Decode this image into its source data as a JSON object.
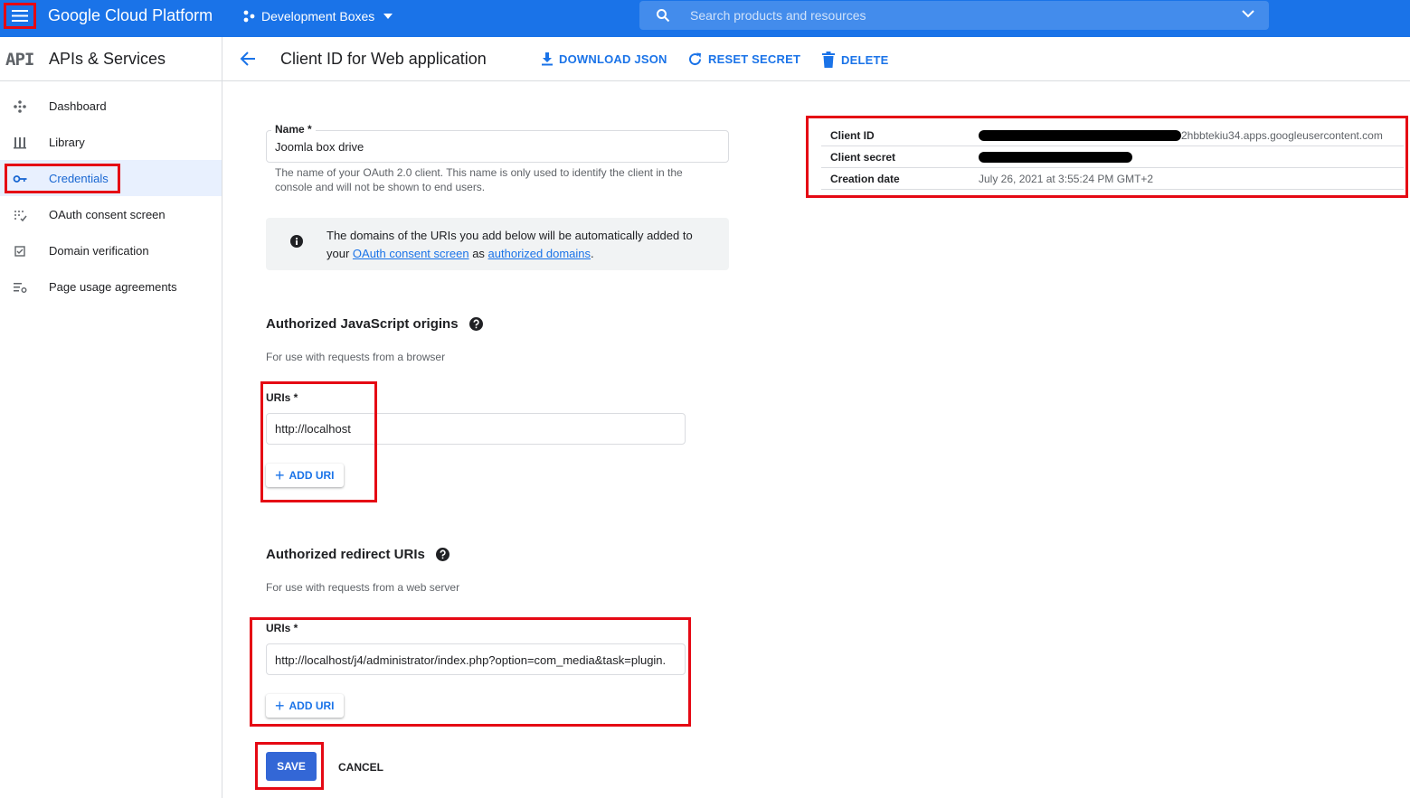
{
  "topbar": {
    "brand": "Google Cloud Platform",
    "project": "Development Boxes",
    "search_placeholder": "Search products and resources"
  },
  "sidebar": {
    "badge": "API",
    "title": "APIs & Services",
    "items": [
      {
        "label": "Dashboard",
        "icon": "dashboard-icon"
      },
      {
        "label": "Library",
        "icon": "library-icon"
      },
      {
        "label": "Credentials",
        "icon": "key-icon",
        "active": true
      },
      {
        "label": "OAuth consent screen",
        "icon": "consent-icon"
      },
      {
        "label": "Domain verification",
        "icon": "checkbox-icon"
      },
      {
        "label": "Page usage agreements",
        "icon": "settings-list-icon"
      }
    ]
  },
  "header": {
    "title": "Client ID for Web application",
    "download": "DOWNLOAD JSON",
    "reset": "RESET SECRET",
    "delete": "DELETE"
  },
  "form": {
    "name_label": "Name *",
    "name_value": "Joomla box drive",
    "name_hint_1": "The name of your OAuth 2.0 client. This name is only used to identify the client in the",
    "name_hint_2": "console and will not be shown to end users.",
    "info_line1": "The domains of the URIs you add below will be automatically added to",
    "info_your": "your",
    "info_link1": "OAuth consent screen",
    "info_as": "as",
    "info_link2": "authorized domains",
    "info_period": ".",
    "js_title": "Authorized JavaScript origins",
    "js_hint": "For use with requests from a browser",
    "js_uris_label": "URIs *",
    "js_uri_value": "http://localhost",
    "add_uri": "ADD URI",
    "redirect_title": "Authorized redirect URIs",
    "redirect_hint": "For use with requests from a web server",
    "redirect_uris_label": "URIs *",
    "redirect_uri_value": "http://localhost/j4/administrator/index.php?option=com_media&task=plugin.",
    "save": "SAVE",
    "cancel": "CANCEL"
  },
  "credentials": {
    "client_id_label": "Client ID",
    "client_id_visible": "2hbbtekiu34.apps.googleusercontent.com",
    "client_secret_label": "Client secret",
    "creation_date_label": "Creation date",
    "creation_date": "July 26, 2021 at 3:55:24 PM GMT+2"
  },
  "colors": {
    "topbar": "#1a73e8",
    "accent": "#1a73e8",
    "save": "#3367d6",
    "highlight": "#e50914"
  }
}
